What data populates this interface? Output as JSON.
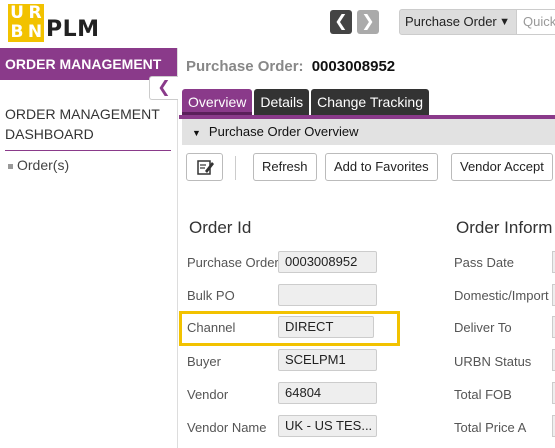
{
  "app": {
    "logo_letters": [
      "U",
      "R",
      "B",
      "N"
    ],
    "brand": "PLM",
    "nav_back": "❮",
    "nav_forward": "❯"
  },
  "search": {
    "type": "Purchase Order",
    "caret": "▼",
    "placeholder": "Quick"
  },
  "sidebar": {
    "header": "ORDER MANAGEMENT",
    "collapse_icon": "❮",
    "item": "ORDER MANAGEMENT DASHBOARD",
    "subitem": "Order(s)"
  },
  "main": {
    "title_label": "Purchase Order:",
    "title_value": "0003008952",
    "tabs": [
      "Overview",
      "Details",
      "Change Tracking"
    ],
    "section": "Purchase Order Overview",
    "toolbar": {
      "refresh": "Refresh",
      "favorites": "Add to Favorites",
      "vendor": "Vendor Accept"
    },
    "order_id_heading": "Order Id",
    "order_info_heading": "Order Inform",
    "fields": [
      {
        "label": "Purchase Order",
        "value": "0003008952"
      },
      {
        "label": "Bulk PO",
        "value": ""
      },
      {
        "label": "Channel",
        "value": "DIRECT"
      },
      {
        "label": "Buyer",
        "value": "SCELPM1"
      },
      {
        "label": "Vendor",
        "value": "64804"
      },
      {
        "label": "Vendor Name",
        "value": "UK - US TES..."
      }
    ],
    "info_fields": [
      "Pass Date",
      "Domestic/Import",
      "Deliver To",
      "URBN Status",
      "Total FOB",
      "Total Price A"
    ]
  },
  "colors": {
    "accent": "#8a3a8a",
    "highlight": "#f2c200"
  }
}
